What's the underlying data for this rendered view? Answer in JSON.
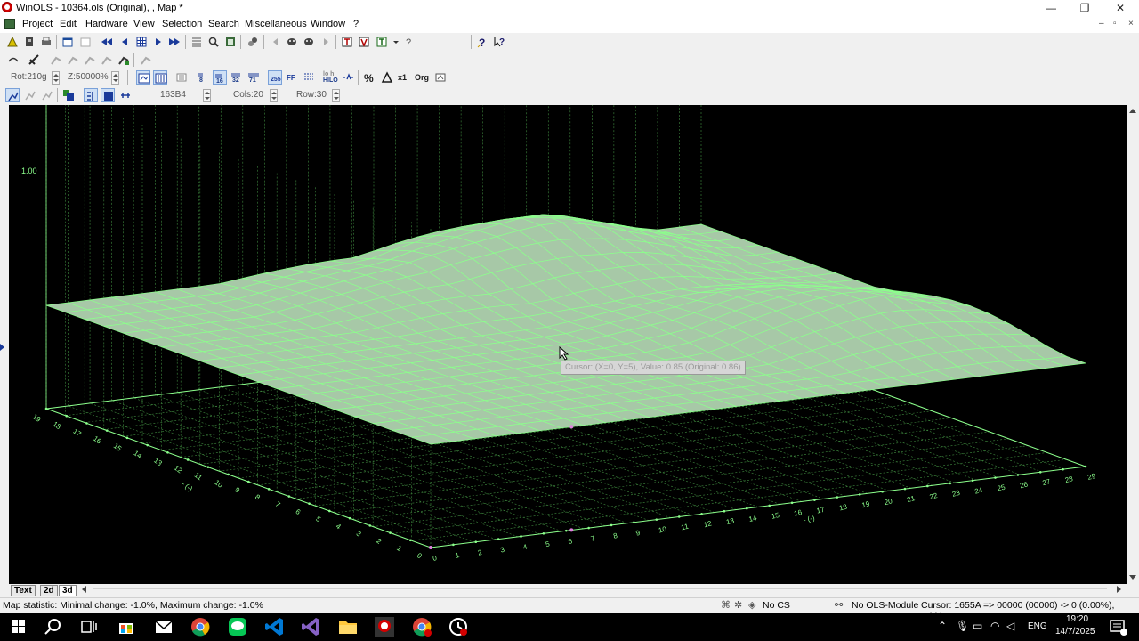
{
  "window": {
    "title": "WinOLS - 10364.ols (Original), , Map *",
    "controls": [
      "—",
      "❐",
      "✕"
    ]
  },
  "menu": {
    "items": [
      "Project",
      "Edit",
      "Hardware",
      "View",
      "Selection",
      "Search",
      "Miscellaneous",
      "Window",
      "?"
    ],
    "mdi_controls": [
      "‒",
      "▫",
      "×"
    ]
  },
  "toolbar3": {
    "rotation": "Rot:210g",
    "zoom": "Z:50000%",
    "tiny_labels": {
      "t8": "8",
      "t16": "16",
      "t32": "32",
      "t71": "71",
      "hilo_top": "lo hi",
      "hilo_bottom": "HILO",
      "fx": "x1",
      "org": "Org"
    }
  },
  "toolbar4": {
    "address": "163B4",
    "cols": "Cols:20",
    "row": "Row:30"
  },
  "plot": {
    "axis_top_label": "1.00",
    "x_ticks": [
      "0",
      "1",
      "2",
      "3",
      "4",
      "5",
      "6",
      "7",
      "8",
      "9",
      "10",
      "11",
      "12",
      "13",
      "14",
      "15",
      "16",
      "17",
      "18",
      "19",
      "20",
      "21",
      "22",
      "23",
      "24",
      "25",
      "26",
      "27",
      "28",
      "29"
    ],
    "y_ticks": [
      "0",
      "1",
      "2",
      "3",
      "4",
      "5",
      "6",
      "7",
      "8",
      "9",
      "10",
      "11",
      "12",
      "13",
      "14",
      "15",
      "16",
      "17",
      "18",
      "19"
    ],
    "x_unit": "- (-)",
    "y_unit": "- (-)",
    "tooltip": "Cursor: (X=0, Y=5), Value: 0.85 (Original: 0.86)",
    "colors": {
      "grid": "#3f8a3f",
      "surface": "#a7c8a7",
      "edge": "#8cff8c",
      "background": "#000000"
    }
  },
  "tabs": [
    "Text",
    "2d",
    "3d"
  ],
  "active_tab": "3d",
  "status": {
    "statistic": "Map statistic: Minimal change: -1.0%, Maximum change: -1.0%",
    "cs": "No CS",
    "module": "No OLS-Module",
    "cursor": "Cursor: 1655A => 00000 (00000) -> 0 (0.00%), Width: 20"
  },
  "taskbar": {
    "lang": "ENG",
    "time": "19:20",
    "date": "14/7/2025"
  }
}
